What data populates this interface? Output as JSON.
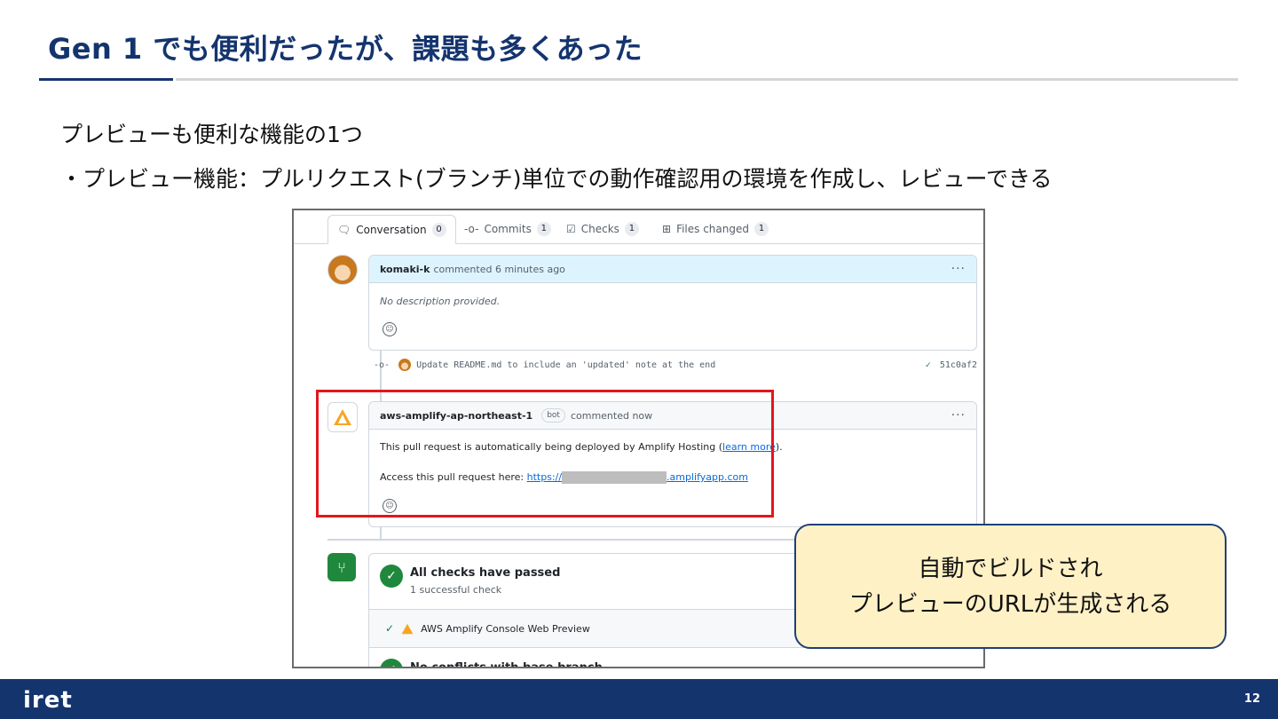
{
  "slide": {
    "title": "Gen 1 でも便利だったが、課題も多くあった",
    "bullet1": "プレビューも便利な機能の1つ",
    "bullet2": "・プレビュー機能：プルリクエスト(ブランチ)単位での動作確認用の環境を作成し、レビューできる",
    "callout_line1": "自動でビルドされ",
    "callout_line2": "プレビューのURLが生成される",
    "page_number": "12",
    "footer_logo": "iret"
  },
  "pr": {
    "tabs": [
      {
        "label": "Conversation",
        "count": "0",
        "icon": "conversation-icon"
      },
      {
        "label": "Commits",
        "count": "1",
        "icon": "commit-icon"
      },
      {
        "label": "Checks",
        "count": "1",
        "icon": "checks-icon"
      },
      {
        "label": "Files changed",
        "count": "1",
        "icon": "file-diff-icon"
      }
    ],
    "comment1": {
      "author": "komaki-k",
      "meta": "commented 6 minutes ago",
      "body": "No description provided."
    },
    "commit": {
      "message": "Update README.md to include an 'updated' note at the end",
      "hash": "51c0af2"
    },
    "comment2": {
      "author": "aws-amplify-ap-northeast-1",
      "badge": "bot",
      "meta": "commented now",
      "line1_pre": "This pull request is automatically being deployed by Amplify Hosting (",
      "line1_link": "learn more",
      "line1_post": ").",
      "line2_pre": "Access this pull request here: ",
      "link_start": "https://",
      "link_end": ".amplifyapp.com"
    },
    "checks": {
      "title": "All checks have passed",
      "subtitle": "1 successful check",
      "item": "AWS Amplify Console Web Preview",
      "conflicts": "No conflicts with base branch"
    }
  },
  "colors": {
    "title_navy": "#14346e",
    "highlight_red": "#e4161b",
    "callout_fill": "#fff1c6",
    "success_green": "#1f883d",
    "link_blue": "#0969da"
  }
}
